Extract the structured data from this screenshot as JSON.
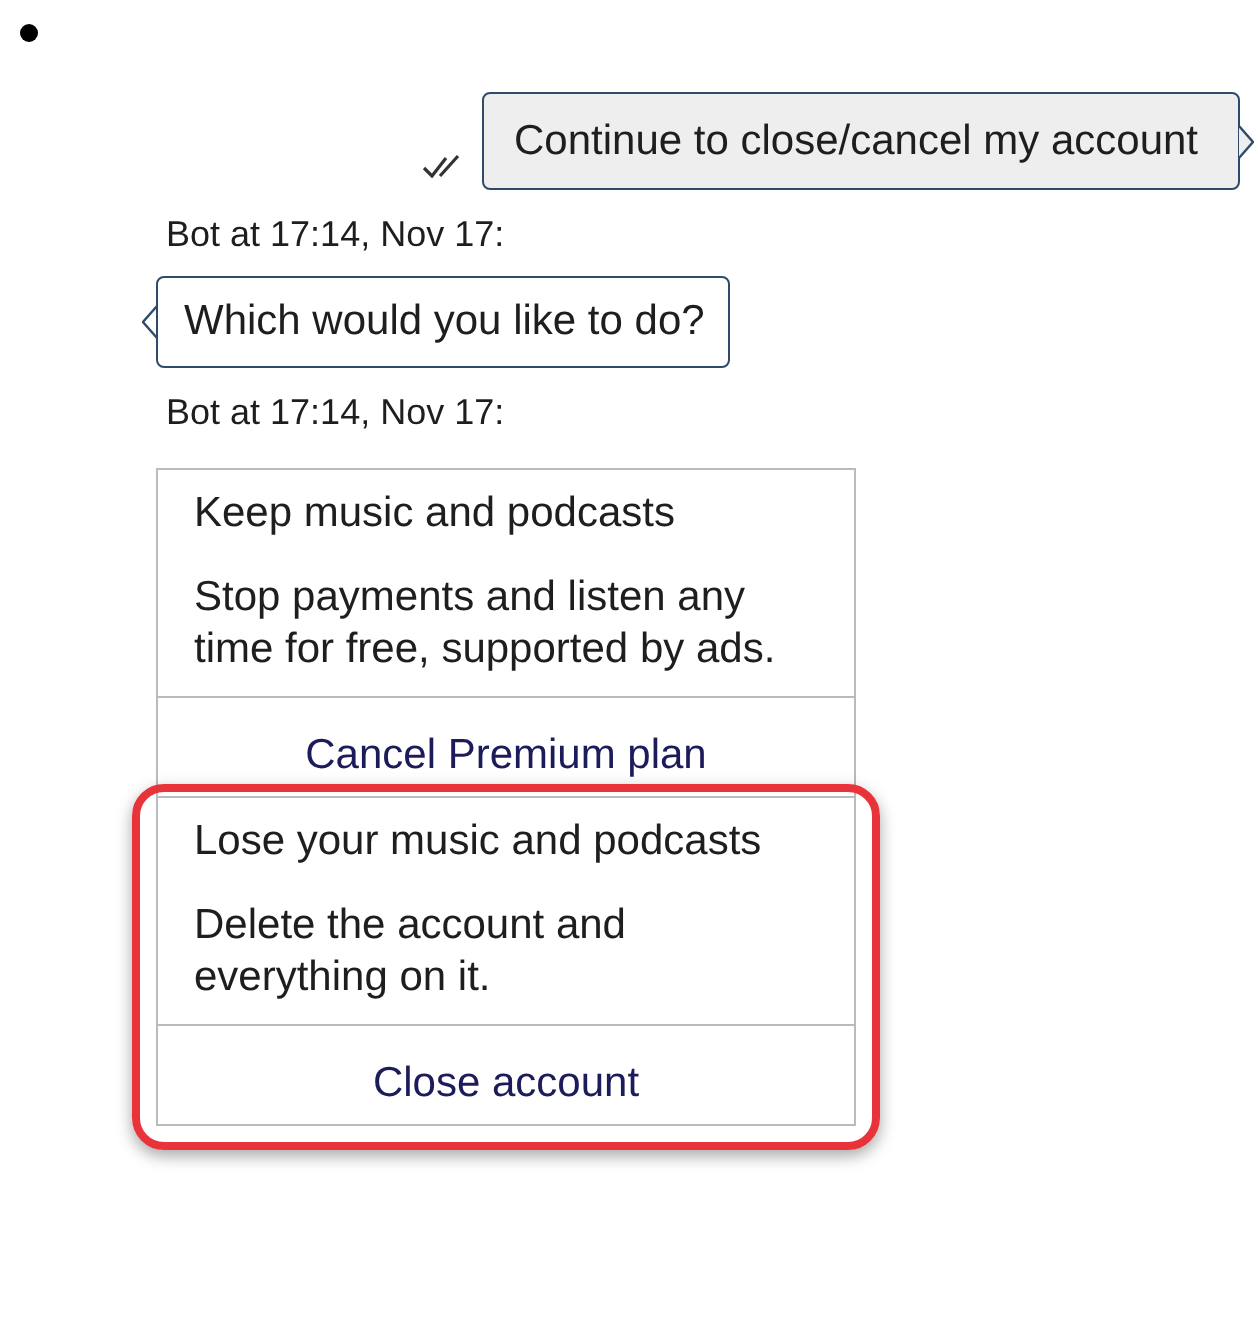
{
  "messages": [
    {
      "kind": "user",
      "text": "Continue to close/cancel my account",
      "read": true
    },
    {
      "kind": "meta",
      "text": "Bot at 17:14, Nov 17:"
    },
    {
      "kind": "bot",
      "text": "Which would you like to do?"
    },
    {
      "kind": "meta",
      "text": "Bot at 17:14, Nov 17:"
    }
  ],
  "options": [
    {
      "title": "Keep music and podcasts",
      "description": "Stop payments and listen any time for free, supported by ads.",
      "action": "Cancel Premium plan",
      "highlighted": false
    },
    {
      "title": "Lose your music and podcasts",
      "description": "Delete the account and everything on it.",
      "action": "Close account",
      "highlighted": true
    }
  ]
}
